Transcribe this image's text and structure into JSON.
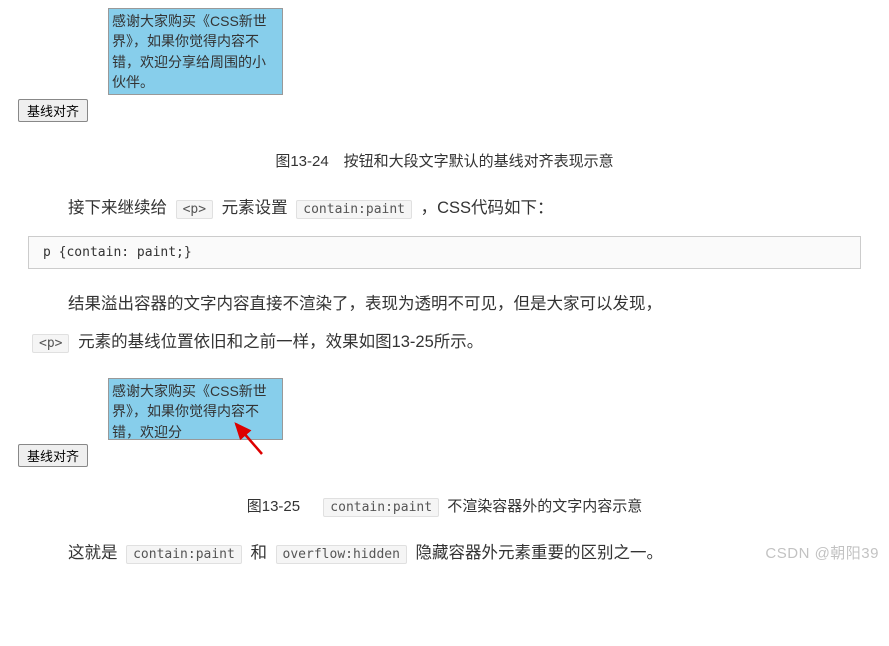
{
  "demo1": {
    "text": "感谢大家购买《CSS新世界》，如果你觉得内容不错，欢迎分享给周围的小伙伴。",
    "button_label": "基线对齐"
  },
  "fig1": {
    "caption": "图13-24　按钮和大段文字默认的基线对齐表现示意"
  },
  "para1_pre": "接下来继续给",
  "para1_code1": "<p>",
  "para1_mid": "元素设置",
  "para1_code2": "contain:paint",
  "para1_suf": "，CSS代码如下：",
  "codeblock": "p {contain: paint;}",
  "para2_line1_pre": "结果溢出容器的文字内容直接不渲染了，表现为透明不可见，但是大家可以发现，",
  "para2_code1": "<p>",
  "para2_line2": "元素的基线位置依旧和之前一样，效果如图13-25所示。",
  "demo2": {
    "text": "感谢大家购买《CSS新世界》，如果你觉得内容不错，欢迎分",
    "button_label": "基线对齐"
  },
  "fig2": {
    "caption_pre": "图13-25　",
    "caption_code": "contain:paint",
    "caption_suf": " 不渲染容器外的文字内容示意"
  },
  "para3_pre": "这就是",
  "para3_code1": "contain:paint",
  "para3_mid": "和",
  "para3_code2": "overflow:hidden",
  "para3_suf": "隐藏容器外元素重要的区别之一。",
  "watermark": "CSDN @朝阳39"
}
